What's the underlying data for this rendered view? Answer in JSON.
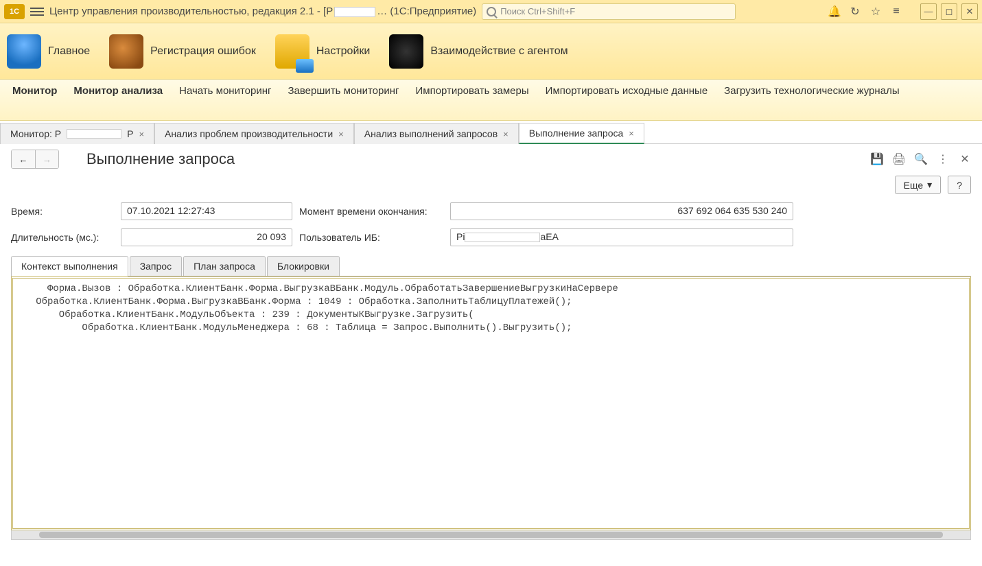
{
  "titlebar": {
    "app_title_prefix": "Центр управления производительностью, редакция 2.1 - [P",
    "app_title_suffix": "… (1С:Предприятие)",
    "search_placeholder": "Поиск Ctrl+Shift+F"
  },
  "main_nav": [
    {
      "label": "Главное"
    },
    {
      "label": "Регистрация ошибок"
    },
    {
      "label": "Настройки"
    },
    {
      "label": "Взаимодействие с агентом"
    }
  ],
  "cmd_bar": [
    {
      "label": "Монитор",
      "bold": true
    },
    {
      "label": "Монитор анализа",
      "bold": true
    },
    {
      "label": "Начать мониторинг"
    },
    {
      "label": "Завершить мониторинг"
    },
    {
      "label": "Импортировать замеры"
    },
    {
      "label": "Импортировать исходные данные"
    },
    {
      "label": "Загрузить технологические журналы"
    }
  ],
  "workspace_tabs": [
    {
      "prefix": "Монитор: P",
      "suffix": "P",
      "masked": true
    },
    {
      "label": "Анализ проблем производительности"
    },
    {
      "label": "Анализ выполнений запросов"
    },
    {
      "label": "Выполнение запроса",
      "active": true
    }
  ],
  "form": {
    "title": "Выполнение запроса",
    "more_btn": "Еще",
    "help_btn": "?",
    "fields": {
      "time_label": "Время:",
      "time_value": "07.10.2021 12:27:43",
      "end_moment_label": "Момент времени окончания:",
      "end_moment_value": "637 692 064 635 530 240",
      "duration_label": "Длительность (мс.):",
      "duration_value": "20 093",
      "user_label": "Пользователь ИБ:",
      "user_prefix": "Pi",
      "user_suffix": "aEA"
    },
    "inner_tabs": [
      {
        "label": "Контекст выполнения",
        "active": true
      },
      {
        "label": "Запрос"
      },
      {
        "label": "План запроса"
      },
      {
        "label": "Блокировки"
      }
    ],
    "context_text": "     Форма.Вызов : Обработка.КлиентБанк.Форма.ВыгрузкаВБанк.Модуль.ОбработатьЗавершениеВыгрузкиНаСервере\n   Обработка.КлиентБанк.Форма.ВыгрузкаВБанк.Форма : 1049 : Обработка.ЗаполнитьТаблицуПлатежей();\n       Обработка.КлиентБанк.МодульОбъекта : 239 : ДокументыКВыгрузке.Загрузить(\n           Обработка.КлиентБанк.МодульМенеджера : 68 : Таблица = Запрос.Выполнить().Выгрузить();"
  }
}
